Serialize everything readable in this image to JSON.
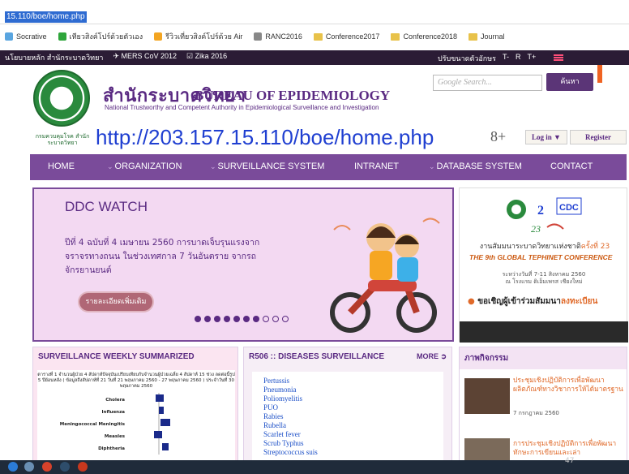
{
  "browser": {
    "url": "15.110/boe/home.php",
    "bookmarks": [
      {
        "label": "Socrative",
        "icon": "socrative-icon",
        "color": "#59a5e0"
      },
      {
        "label": "เทียวสิงค์โปร์ด้วยตัวเอง",
        "icon": "news-icon",
        "color": "#2ea53b"
      },
      {
        "label": "รีวิวเที่ยวสิงค์โปร์ด้วย Air",
        "icon": "star-icon",
        "color": "#f3a522"
      },
      {
        "label": "RANC2016",
        "icon": "page-icon",
        "color": "#888888"
      },
      {
        "label": "Conference2017",
        "icon": "folder-icon",
        "color": "#e8c24a"
      },
      {
        "label": "Conference2018",
        "icon": "folder-icon",
        "color": "#e8c24a"
      },
      {
        "label": "Journal",
        "icon": "folder-icon",
        "color": "#e8c24a"
      }
    ]
  },
  "site_top": {
    "home": "นโยบายหลัก สำนักระบาดวิทยา",
    "links": [
      "✈ MERS CoV 2012",
      "☑ Zika 2016"
    ],
    "font_label": "ปรับขนาดตัวอักษร",
    "font_controls": [
      "T-",
      "R",
      "T+"
    ]
  },
  "header": {
    "logo_caption": "กรมควบคุมโรค สำนักระบาดวิทยา",
    "thai_title": "สำนักระบาดวิทยา",
    "en_title": "BUREAU OF EPIDEMIOLOGY",
    "subtitle": "National Trustworthy and Competent Authority in Epidemiological Surveillance and Investigation",
    "search_placeholder": "Google Search...",
    "search_button": "ค้นหา",
    "overlay_url": "http://203.157.15.110/boe/home.php",
    "social_gplus": "8+",
    "login": "Log in ▼",
    "register": "Register"
  },
  "nav": {
    "items": [
      {
        "label": "HOME",
        "chev": false
      },
      {
        "label": "ORGANIZATION",
        "chev": true
      },
      {
        "label": "SURVEILLANCE SYSTEM",
        "chev": true
      },
      {
        "label": "INTRANET",
        "chev": false
      },
      {
        "label": "DATABASE SYSTEM",
        "chev": true
      },
      {
        "label": "CONTACT",
        "chev": false
      }
    ]
  },
  "ddc": {
    "title": "DDC WATCH",
    "text": "ปีที่ 4 ฉบับที่ 4 เมษายน 2560 การบาดเจ็บรุนแรงจาก จราจรทางถนน ในช่วงเทศกาล 7 วันอันตราย จากรถ จักรยานยนต์",
    "button": "รายละเอียดเพิ่มเติม",
    "slides_total": 10,
    "slide_active_upto": 7
  },
  "ad": {
    "text1a": "งานสัมมนาระบาดวิทยาแห่งชาติ",
    "text1b": "ครั้งที่ 23",
    "text2": "THE 9th GLOBAL TEPHINET CONFERENCE",
    "text3": "ระหว่างวันที่ 7-11 สิงหาคม 2560\nณ โรงแรม ดิเอ็มเพรส เชียงใหม่",
    "text4a": "ขอเชิญผู้เข้าร่วมสัมมนา",
    "text4b": "ลงทะเบียน"
  },
  "panels": {
    "surveillance": {
      "title": "SURVEILLANCE WEEKLY SUMMARIZED",
      "caption": "ตารางที่ 1 จำนวนผู้ป่วย 4 สัปดาห์ปัจจุบันเปรียบเทียบกับจำนวนผู้ป่วยเฉลี่ย 4 สัปดาห์ 15 ช่วง ลดต่อนี้รูป 5 ปีย้อนหลัง ( ข้อมูลถึงสัปดาห์ที่ 21 วันที่ 21 พฤษภาคม 2560 - 27 พฤษภาคม 2560 ) ประจำวันที่ 30 พฤษภาคม 2560",
      "chart_rows": [
        "Cholera",
        "Influenza",
        "Meningococcal Meningitis",
        "Measles",
        "Diphtheria"
      ]
    },
    "r506": {
      "title": "R506 :: DISEASES SURVEILLANCE",
      "more": "MORE ➲",
      "items": [
        "Pertussis",
        "Pneumonia",
        "Poliomyelitis",
        "PUO",
        "Rabies",
        "Rubella",
        "Scarlet fever",
        "Scrub Typhus",
        "Streptococcus suis"
      ]
    },
    "news": {
      "title": "ภาพกิจกรรม",
      "items": [
        {
          "text": "ประชุมเชิงปฏิบัติการเพื่อพัฒนาผลิตภัณฑ์ทางวิชาการให้ได้มาตรฐาน",
          "date": "7 กรกฎาคม 2560"
        },
        {
          "text": "การประชุมเชิงปฏิบัติการเพื่อพัฒนาทักษะการเขียนและเล่า",
          "date": ""
        }
      ]
    }
  },
  "page_number": "47"
}
